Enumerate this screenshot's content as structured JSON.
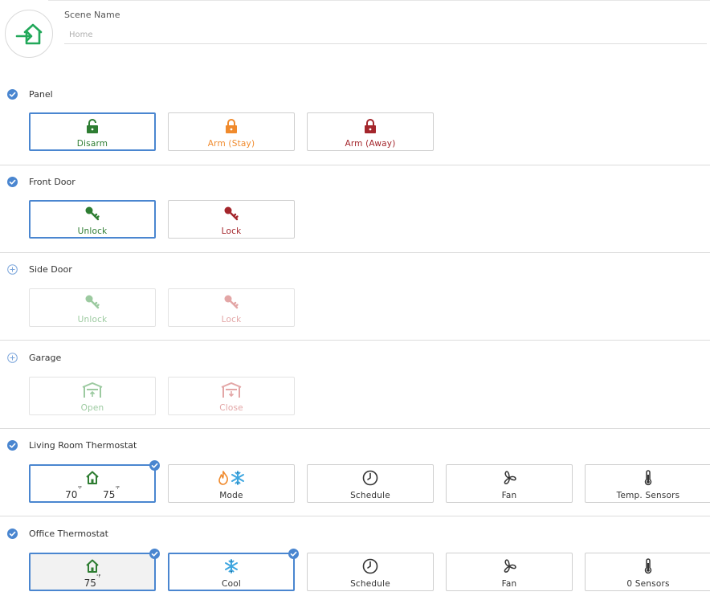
{
  "header": {
    "label": "Scene Name",
    "placeholder": "Home"
  },
  "colors": {
    "accent": "#4a86d0",
    "green": "#2e7d32",
    "orange": "#f08a2c",
    "red": "#a4262c"
  },
  "sections": {
    "panel": {
      "title": "Panel",
      "checked": true,
      "options": [
        "Disarm",
        "Arm (Stay)",
        "Arm (Away)"
      ]
    },
    "front_door": {
      "title": "Front Door",
      "checked": true,
      "options": [
        "Unlock",
        "Lock"
      ]
    },
    "side_door": {
      "title": "Side Door",
      "checked": false,
      "options": [
        "Unlock",
        "Lock"
      ]
    },
    "garage": {
      "title": "Garage",
      "checked": false,
      "options": [
        "Open",
        "Close"
      ]
    },
    "living_thermostat": {
      "title": "Living Room Thermostat",
      "checked": true,
      "heat": "70",
      "cool": "75",
      "unit": "°F",
      "options": [
        "Mode",
        "Schedule",
        "Fan",
        "Temp. Sensors"
      ]
    },
    "office_thermostat": {
      "title": "Office Thermostat",
      "checked": true,
      "cool": "75",
      "unit": "°F",
      "options": [
        "Cool",
        "Schedule",
        "Fan",
        "0 Sensors"
      ]
    }
  }
}
